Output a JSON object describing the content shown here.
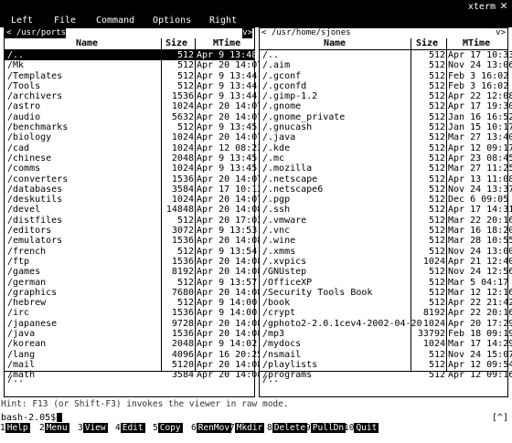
{
  "window": {
    "title": "xterm"
  },
  "menu": [
    "Left",
    "File",
    "Command",
    "Options",
    "Right"
  ],
  "left_panel": {
    "path": "< /usr/ports",
    "path_end": "v>",
    "columns": [
      "Name",
      "Size",
      "MTime"
    ],
    "rows": [
      {
        "name": "/..",
        "size": "512",
        "mtime": "Apr  9 13:48",
        "selected": true
      },
      {
        "name": "/Mk",
        "size": "512",
        "mtime": "Apr 20 14:07"
      },
      {
        "name": "/Templates",
        "size": "512",
        "mtime": "Apr  9 13:44"
      },
      {
        "name": "/Tools",
        "size": "512",
        "mtime": "Apr  9 13:44"
      },
      {
        "name": "/archivers",
        "size": "1536",
        "mtime": "Apr  9 13:44"
      },
      {
        "name": "/astro",
        "size": "1024",
        "mtime": "Apr 20 14:07"
      },
      {
        "name": "/audio",
        "size": "5632",
        "mtime": "Apr 20 14:07"
      },
      {
        "name": "/benchmarks",
        "size": "512",
        "mtime": "Apr  9 13:45"
      },
      {
        "name": "/biology",
        "size": "1024",
        "mtime": "Apr 20 14:07"
      },
      {
        "name": "/cad",
        "size": "1024",
        "mtime": "Apr 12 08:23"
      },
      {
        "name": "/chinese",
        "size": "2048",
        "mtime": "Apr  9 13:45"
      },
      {
        "name": "/comms",
        "size": "1024",
        "mtime": "Apr  9 13:45"
      },
      {
        "name": "/converters",
        "size": "1536",
        "mtime": "Apr 20 14:07"
      },
      {
        "name": "/databases",
        "size": "3584",
        "mtime": "Apr 17 10:13"
      },
      {
        "name": "/deskutils",
        "size": "1024",
        "mtime": "Apr 20 14:07"
      },
      {
        "name": "/devel",
        "size": "14848",
        "mtime": "Apr 20 14:08"
      },
      {
        "name": "/distfiles",
        "size": "512",
        "mtime": "Apr 20 17:02"
      },
      {
        "name": "/editors",
        "size": "3072",
        "mtime": "Apr  9 13:53"
      },
      {
        "name": "/emulators",
        "size": "1536",
        "mtime": "Apr 20 14:08"
      },
      {
        "name": "/french",
        "size": "512",
        "mtime": "Apr  9 13:54"
      },
      {
        "name": "/ftp",
        "size": "1536",
        "mtime": "Apr 20 14:08"
      },
      {
        "name": "/games",
        "size": "8192",
        "mtime": "Apr 20 14:08"
      },
      {
        "name": "/german",
        "size": "512",
        "mtime": "Apr  9 13:57"
      },
      {
        "name": "/graphics",
        "size": "7680",
        "mtime": "Apr 20 14:08"
      },
      {
        "name": "/hebrew",
        "size": "512",
        "mtime": "Apr  9 14:00"
      },
      {
        "name": "/irc",
        "size": "1536",
        "mtime": "Apr  9 14:00"
      },
      {
        "name": "/japanese",
        "size": "9728",
        "mtime": "Apr 20 14:08"
      },
      {
        "name": "/java",
        "size": "1536",
        "mtime": "Apr 20 14:08"
      },
      {
        "name": "/korean",
        "size": "2048",
        "mtime": "Apr  9 14:02"
      },
      {
        "name": "/lang",
        "size": "4096",
        "mtime": "Apr 16 20:25"
      },
      {
        "name": "/mail",
        "size": "5120",
        "mtime": "Apr 20 14:08"
      },
      {
        "name": "/math",
        "size": "3584",
        "mtime": "Apr 20 14:08"
      }
    ],
    "mini": "/.."
  },
  "right_panel": {
    "path": "< /usr/home/sjones",
    "path_end": "v>",
    "columns": [
      "Name",
      "Size",
      "MTime"
    ],
    "rows": [
      {
        "name": "/..",
        "size": "512",
        "mtime": "Apr 17 10:33"
      },
      {
        "name": "/.aim",
        "size": "512",
        "mtime": "Nov 24 13:06"
      },
      {
        "name": "/.gconf",
        "size": "512",
        "mtime": "Feb  3 16:02"
      },
      {
        "name": "/.gconfd",
        "size": "512",
        "mtime": "Feb  3 16:02"
      },
      {
        "name": "/.gimp-1.2",
        "size": "512",
        "mtime": "Apr 22 12:08"
      },
      {
        "name": "/.gnome",
        "size": "512",
        "mtime": "Apr 17 19:30"
      },
      {
        "name": "/.gnome_private",
        "size": "512",
        "mtime": "Jan 16 16:52"
      },
      {
        "name": "/.gnucash",
        "size": "512",
        "mtime": "Jan 15 10:17"
      },
      {
        "name": "/.java",
        "size": "512",
        "mtime": "Mar 27 13:40"
      },
      {
        "name": "/.kde",
        "size": "512",
        "mtime": "Apr 12 09:17"
      },
      {
        "name": "/.mc",
        "size": "512",
        "mtime": "Apr 23 08:45"
      },
      {
        "name": "/.mozilla",
        "size": "512",
        "mtime": "Mar 27 11:25"
      },
      {
        "name": "/.netscape",
        "size": "512",
        "mtime": "Apr 13 11:08"
      },
      {
        "name": "/.netscape6",
        "size": "512",
        "mtime": "Nov 24 13:37"
      },
      {
        "name": "/.pgp",
        "size": "512",
        "mtime": "Dec  6 09:05"
      },
      {
        "name": "/.ssh",
        "size": "512",
        "mtime": "Apr 17 14:31"
      },
      {
        "name": "/.vmware",
        "size": "512",
        "mtime": "Mar 22 20:16"
      },
      {
        "name": "/.vnc",
        "size": "512",
        "mtime": "Mar 16 18:20"
      },
      {
        "name": "/.wine",
        "size": "512",
        "mtime": "Mar 28 10:55"
      },
      {
        "name": "/.xmms",
        "size": "512",
        "mtime": "Nov 24 13:00"
      },
      {
        "name": "/.xvpics",
        "size": "1024",
        "mtime": "Apr 21 12:40"
      },
      {
        "name": "/GNUstep",
        "size": "512",
        "mtime": "Nov 24 12:56"
      },
      {
        "name": "/OfficeXP",
        "size": "512",
        "mtime": "Mar  5 04:17"
      },
      {
        "name": "/Security Tools Book",
        "size": "512",
        "mtime": "Mar 12 12:16"
      },
      {
        "name": "/book",
        "size": "512",
        "mtime": "Apr 22 21:42"
      },
      {
        "name": "/crypt",
        "size": "8192",
        "mtime": "Apr 22 20:16"
      },
      {
        "name": "/gphoto2-2.0.1cev4-2002-04-20",
        "size": "1024",
        "mtime": "Apr 20 17:29"
      },
      {
        "name": "/mp3",
        "size": "33792",
        "mtime": "Feb 18 09:19"
      },
      {
        "name": "/mydocs",
        "size": "1024",
        "mtime": "Mar 17 14:29"
      },
      {
        "name": "/nsmail",
        "size": "512",
        "mtime": "Nov 24 15:07"
      },
      {
        "name": "/playlists",
        "size": "512",
        "mtime": "Apr 12 09:54"
      },
      {
        "name": "/programs",
        "size": "512",
        "mtime": "Apr 12 09:16"
      }
    ],
    "mini": "/.."
  },
  "hint": "Hint: F13 (or Shift-F3) invokes the viewer in raw mode.",
  "prompt": "bash-2.05$",
  "bracket": "[^]",
  "fkeys": [
    {
      "num": "1",
      "label": "Help"
    },
    {
      "num": "2",
      "label": "Menu"
    },
    {
      "num": "3",
      "label": "View"
    },
    {
      "num": "4",
      "label": "Edit"
    },
    {
      "num": "5",
      "label": "Copy"
    },
    {
      "num": "6",
      "label": "RenMov"
    },
    {
      "num": "7",
      "label": "Mkdir"
    },
    {
      "num": "8",
      "label": "Delete"
    },
    {
      "num": "9",
      "label": "PullDn"
    },
    {
      "num": "10",
      "label": "Quit"
    }
  ]
}
